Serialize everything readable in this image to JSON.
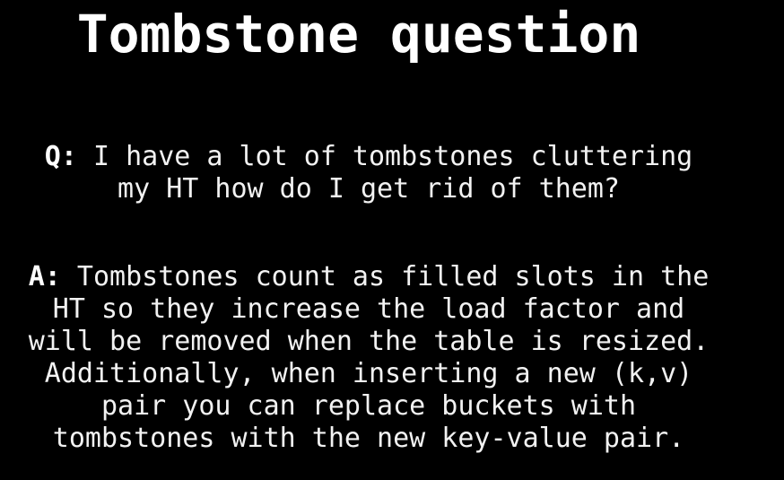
{
  "title": "Tombstone question",
  "question": {
    "prefix": "Q:",
    "lines": [
      " I have a lot of tombstones cluttering",
      "my HT how do I get rid of them?"
    ]
  },
  "answer": {
    "prefix": "A:",
    "lines": [
      " Tombstones count as filled slots in the",
      "HT so they increase the load factor and",
      "will be removed when the table is resized.",
      "Additionally, when inserting a new (k,v)",
      "pair you can replace buckets with",
      "tombstones with the new key-value pair."
    ]
  }
}
